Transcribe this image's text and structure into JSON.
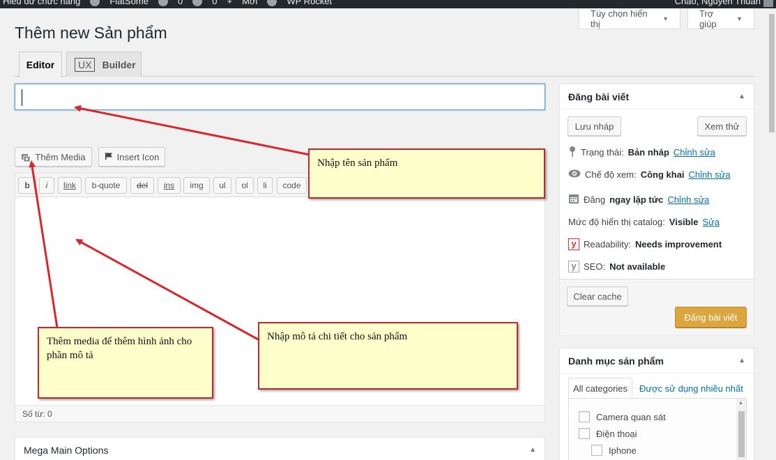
{
  "adminbar": {
    "items": [
      "Hiểu dữ chức năng",
      "FlatSome",
      "0",
      "0",
      "Mới",
      "WP Rocket"
    ],
    "greeting": "Chào, Nguyễn Thuần"
  },
  "screen_options": {
    "display_label": "Tùy chọn hiển thị",
    "help_label": "Trợ giúp"
  },
  "page_title": "Thêm new Sản phẩm",
  "editor_tabs": {
    "editor": "Editor",
    "ux": "UX",
    "builder": "Builder"
  },
  "title_input": {
    "value": "",
    "placeholder": ""
  },
  "media_buttons": {
    "add_media": "Thêm Media",
    "insert_icon": "Insert Icon"
  },
  "quicktags": [
    "b",
    "i",
    "link",
    "b-quote",
    "del",
    "ins",
    "img",
    "ul",
    "ol",
    "li",
    "code"
  ],
  "word_count": "Số từ: 0",
  "mega_options": {
    "title": "Mega Main Options"
  },
  "publish_box": {
    "title": "Đăng bài viết",
    "save_draft": "Lưu nháp",
    "preview": "Xem thử",
    "status_label": "Trạng thái:",
    "status_value": "Bản nháp",
    "status_edit": "Chỉnh sửa",
    "visibility_label": "Chế độ xem:",
    "visibility_value": "Công khai",
    "visibility_edit": "Chỉnh sửa",
    "publish_time_label": "Đăng",
    "publish_time_value": "ngay lập tức",
    "publish_time_edit": "Chỉnh sửa",
    "catalog_label": "Mức độ hiển thị catalog:",
    "catalog_value": "Visible",
    "catalog_edit": "Sửa",
    "readability_label": "Readability:",
    "readability_value": "Needs improvement",
    "seo_label": "SEO:",
    "seo_value": "Not available",
    "clear_cache": "Clear cache",
    "publish": "Đăng bài viết"
  },
  "category_box": {
    "title": "Danh mục sản phẩm",
    "tab_all": "All categories",
    "tab_popular": "Được sử dụng nhiều nhất",
    "items": [
      {
        "label": "Camera quan sát",
        "level": 0
      },
      {
        "label": "Điện thoại",
        "level": 0
      },
      {
        "label": "Iphone",
        "level": 1
      }
    ]
  },
  "annotations": {
    "title_note": "Nhập tên sản phẩm",
    "desc_note": "Nhập mô tả chi tiết cho sản phẩm",
    "media_note": "Thêm media để thêm hình ảnh cho phần mô tả"
  },
  "colors": {
    "publish_button": "#dba540",
    "link": "#0073aa",
    "annotation_border": "#c0282d",
    "annotation_fill": "#ffffcc",
    "readability_icon": "#dc3232"
  }
}
